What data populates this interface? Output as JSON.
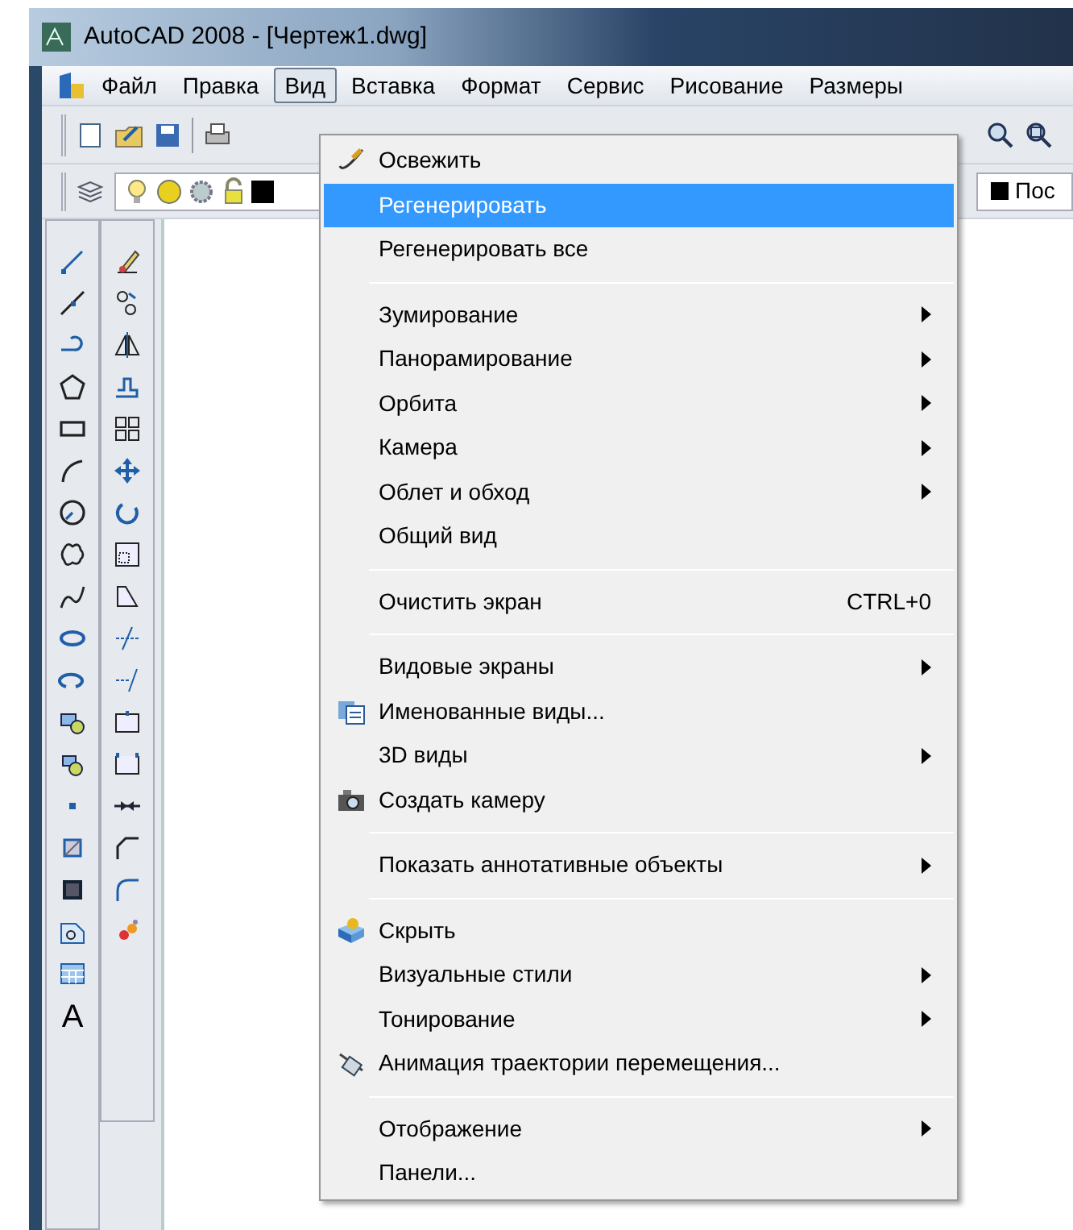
{
  "window": {
    "title": "AutoCAD 2008 - [Чертеж1.dwg]"
  },
  "menu_bar": [
    {
      "label": "Файл",
      "selected": false
    },
    {
      "label": "Правка",
      "selected": false
    },
    {
      "label": "Вид",
      "selected": true
    },
    {
      "label": "Вставка",
      "selected": false
    },
    {
      "label": "Формат",
      "selected": false
    },
    {
      "label": "Сервис",
      "selected": false
    },
    {
      "label": "Рисование",
      "selected": false
    },
    {
      "label": "Размеры",
      "selected": false
    }
  ],
  "properties_toolbar": {
    "color_field": "Пос"
  },
  "draw_toolbar": {
    "text_tool_label": "A"
  },
  "view_menu": [
    {
      "kind": "item",
      "label": "Освежить",
      "submenu": false,
      "selected": false
    },
    {
      "kind": "item",
      "label": "Регенерировать",
      "submenu": false,
      "selected": true
    },
    {
      "kind": "item",
      "label": "Регенерировать все",
      "submenu": false,
      "selected": false
    },
    {
      "kind": "separator"
    },
    {
      "kind": "item",
      "label": "Зумирование",
      "submenu": true,
      "selected": false
    },
    {
      "kind": "item",
      "label": "Панорамирование",
      "submenu": true,
      "selected": false
    },
    {
      "kind": "item",
      "label": "Орбита",
      "submenu": true,
      "selected": false
    },
    {
      "kind": "item",
      "label": "Камера",
      "submenu": true,
      "selected": false
    },
    {
      "kind": "item",
      "label": "Облет и обход",
      "submenu": true,
      "selected": false
    },
    {
      "kind": "item",
      "label": "Общий вид",
      "submenu": false,
      "selected": false
    },
    {
      "kind": "separator"
    },
    {
      "kind": "item",
      "label": "Очистить экран",
      "shortcut": "CTRL+0",
      "submenu": false,
      "selected": false
    },
    {
      "kind": "separator"
    },
    {
      "kind": "item",
      "label": "Видовые экраны",
      "submenu": true,
      "selected": false
    },
    {
      "kind": "item",
      "label": "Именованные виды...",
      "submenu": false,
      "selected": false
    },
    {
      "kind": "item",
      "label": "3D виды",
      "submenu": true,
      "selected": false
    },
    {
      "kind": "item",
      "label": "Создать камеру",
      "submenu": false,
      "selected": false
    },
    {
      "kind": "separator"
    },
    {
      "kind": "item",
      "label": "Показать аннотативные объекты",
      "submenu": true,
      "selected": false
    },
    {
      "kind": "separator"
    },
    {
      "kind": "item",
      "label": "Скрыть",
      "submenu": false,
      "selected": false
    },
    {
      "kind": "item",
      "label": "Визуальные стили",
      "submenu": true,
      "selected": false
    },
    {
      "kind": "item",
      "label": "Тонирование",
      "submenu": true,
      "selected": false
    },
    {
      "kind": "item",
      "label": "Анимация траектории перемещения...",
      "submenu": false,
      "selected": false
    },
    {
      "kind": "separator"
    },
    {
      "kind": "item",
      "label": "Отображение",
      "submenu": true,
      "selected": false
    },
    {
      "kind": "item",
      "label": "Панели...",
      "submenu": false,
      "selected": false
    }
  ]
}
